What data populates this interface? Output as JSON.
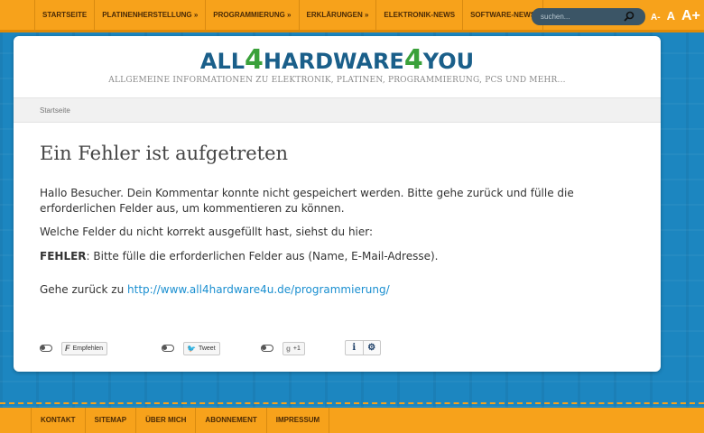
{
  "nav": {
    "items": [
      "Startseite",
      "Platinenherstellung »",
      "Programmierung »",
      "Erklärungen »",
      "Elektronik-News",
      "Software-News"
    ]
  },
  "search": {
    "placeholder": "suchen..."
  },
  "font_controls": {
    "small": "A-",
    "medium": "A",
    "large": "A+"
  },
  "logo": {
    "part1": "ALL",
    "four1": "4",
    "part2": "HARDWARE",
    "four2": "4",
    "part3": "YOU"
  },
  "tagline": "ALLGEMEINE INFORMATIONEN ZU ELEKTRONIK, PLATINEN, PROGRAMMIERUNG, PCS UND MEHR...",
  "breadcrumb": "Startseite",
  "content": {
    "heading": "Ein Fehler ist aufgetreten",
    "paragraph1": "Hallo Besucher. Dein Kommentar konnte nicht gespeichert werden. Bitte gehe zurück und fülle die erforderlichen Felder aus, um kommentieren zu können.",
    "paragraph2": "Welche Felder du nicht korrekt ausgefüllt hast, siehst du hier:",
    "error_label": "FEHLER",
    "error_text": ": Bitte fülle die erforderlichen Felder aus (Name, E-Mail-Adresse).",
    "back_prefix": "Gehe zurück zu ",
    "back_link": "http://www.all4hardware4u.de/programmierung/"
  },
  "social": {
    "facebook_label": "Empfehlen",
    "twitter_label": "Tweet",
    "gplus_label": "+1",
    "info_label": "i"
  },
  "footer": {
    "items": [
      "Kontakt",
      "Sitemap",
      "Über mich",
      "Abonnement",
      "Impressum"
    ]
  },
  "colors": {
    "nav_bg": "#f7a21b",
    "page_bg": "#1c86c0",
    "logo_blue": "#1a5f8a",
    "logo_green": "#3aa13a",
    "link": "#1a8fd0"
  }
}
